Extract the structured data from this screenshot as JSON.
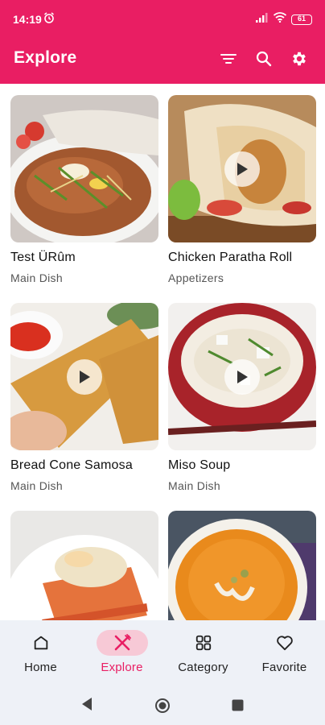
{
  "status": {
    "time": "14:19",
    "battery": "61"
  },
  "app_bar": {
    "title": "Explore"
  },
  "recipes": [
    {
      "title": "Test ÜRûm",
      "category": "Main Dish"
    },
    {
      "title": "Chicken Paratha Roll",
      "category": "Appetizers"
    },
    {
      "title": "Bread Cone Samosa",
      "category": "Main Dish"
    },
    {
      "title": "Miso Soup",
      "category": "Main Dish"
    },
    {
      "title": "",
      "category": ""
    },
    {
      "title": "",
      "category": ""
    }
  ],
  "nav": {
    "home": "Home",
    "explore": "Explore",
    "category": "Category",
    "favorite": "Favorite"
  },
  "colors": {
    "accent": "#e91e63",
    "nav_bg": "#eef1f7",
    "active_pill": "#f7c9d6"
  }
}
